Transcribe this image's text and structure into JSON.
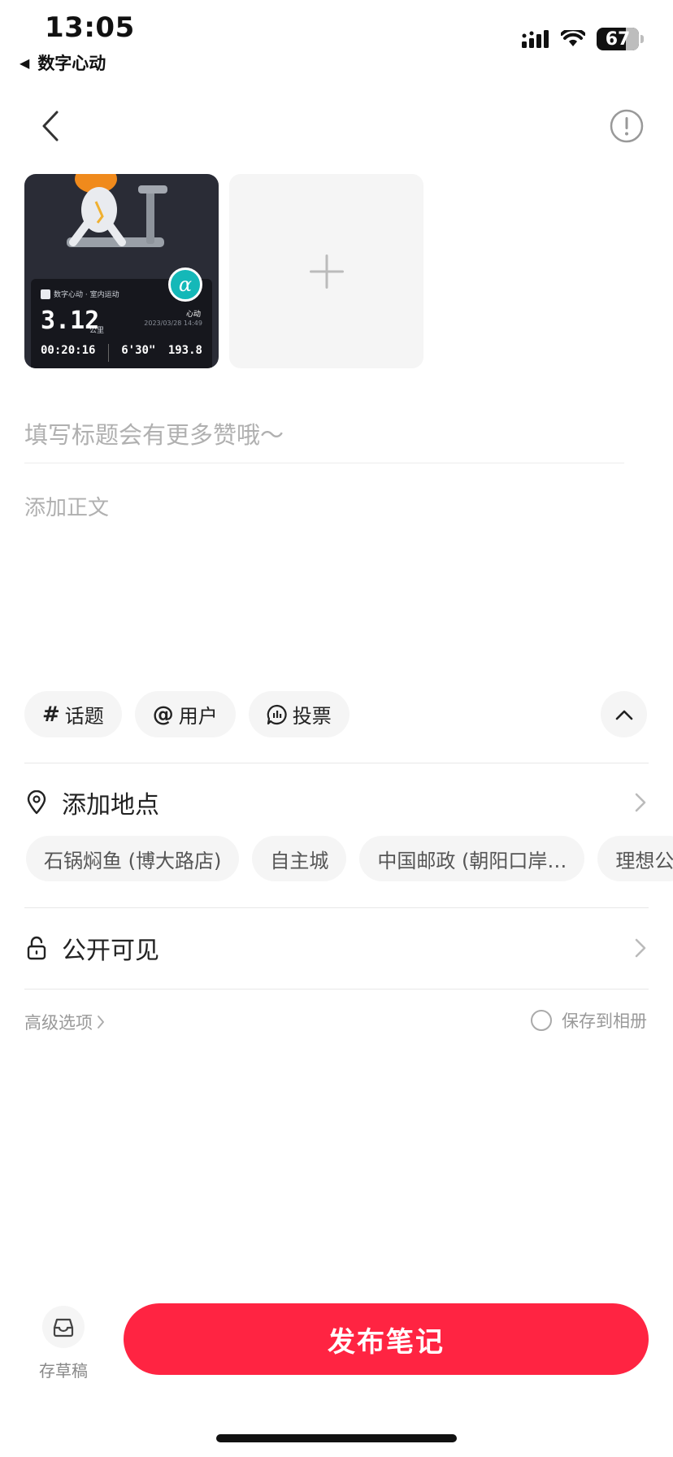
{
  "status_bar": {
    "time": "13:05",
    "back_app": "数字心动",
    "battery": "67",
    "icons": [
      "signal-icon",
      "wifi-icon",
      "battery-icon"
    ]
  },
  "nav": {
    "back_icon": "chevron-left-icon",
    "info_icon": "exclamation-circle-icon"
  },
  "media": {
    "thumbnail": {
      "app_name": "数字心动 · 室内运动",
      "distance": "3.12",
      "unit": "公里",
      "date": "2023/03/28 14:49",
      "logo_caption": "心动",
      "stats": [
        "00:20:16",
        "6'30\"",
        "193.8"
      ]
    },
    "add_icon": "plus-icon"
  },
  "editor": {
    "title_placeholder": "填写标题会有更多赞哦～",
    "body_placeholder": "添加正文"
  },
  "chips": [
    {
      "symbol": "#",
      "label": "话题"
    },
    {
      "symbol": "@",
      "label": "用户"
    },
    {
      "symbol": "",
      "label": "投票"
    }
  ],
  "location": {
    "label": "添加地点",
    "icon": "location-pin-icon",
    "suggestions": [
      "石锅焖鱼 (博大路店)",
      "自主城",
      "中国邮政 (朝阳口岸…",
      "理想公"
    ]
  },
  "visibility": {
    "label": "公开可见",
    "icon": "unlock-icon"
  },
  "advanced": {
    "label": "高级选项"
  },
  "save_album": {
    "label": "保存到相册",
    "checked": false
  },
  "bottom": {
    "draft_label": "存草稿",
    "draft_icon": "inbox-icon",
    "publish_label": "发布笔记",
    "accent": "#ff2442"
  }
}
